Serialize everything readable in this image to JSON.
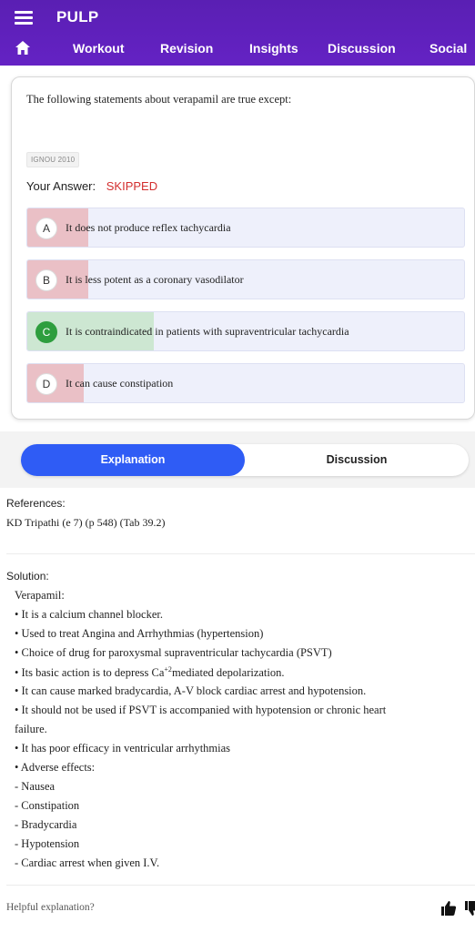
{
  "app": {
    "title": "PULP",
    "nav": [
      "Workout",
      "Revision",
      "Insights",
      "Discussion",
      "Social"
    ]
  },
  "question": {
    "text": "The following statements about verapamil are true except:",
    "source_tag": "IGNOU 2010",
    "your_answer_label": "Your Answer:",
    "your_answer_value": "SKIPPED",
    "options": [
      {
        "letter": "A",
        "text": "It does not produce reflex tachycardia",
        "status": "wrong",
        "response_share": 0.14
      },
      {
        "letter": "B",
        "text": "It is less potent as a coronary vasodilator",
        "status": "wrong",
        "response_share": 0.14
      },
      {
        "letter": "C",
        "text": "It is contraindicated in patients with supraventricular tachycardia",
        "status": "correct",
        "response_share": 0.29
      },
      {
        "letter": "D",
        "text": "It can cause constipation",
        "status": "wrong",
        "response_share": 0.13
      }
    ]
  },
  "tabs": {
    "explanation": "Explanation",
    "discussion": "Discussion"
  },
  "explanation": {
    "references_heading": "References:",
    "references_text": "KD Tripathi (e 7) (p 548) (Tab 39.2)",
    "solution_heading": "Solution:",
    "solution_lines": [
      "Verapamil:",
      "•  It is a calcium channel blocker.",
      "•  Used to treat Angina and Arrhythmias (hypertension)",
      "• Choice of drug for paroxysmal supraventricular tachycardia (PSVT)",
      "• Its basic action is to depress Ca",
      "+2",
      "mediated depolarization.",
      "•  It can cause marked bradycardia, A-V block cardiac arrest and hypotension.",
      "•  It should not be used if PSVT is accompanied with hypotension or chronic heart",
      "failure.",
      "•  It has poor efficacy in ventricular arrhythmias",
      "•  Adverse effects:",
      "-   Nausea",
      "-   Constipation",
      "-   Bradycardia",
      "-   Hypotension",
      "-   Cardiac arrest when given I.V."
    ],
    "helpful_prompt": "Helpful explanation?"
  },
  "colors": {
    "appbar": "#5b21b6",
    "tab_active": "#2f5cf5",
    "wrong_fill": "#eac0c6",
    "correct_fill": "#cde7d2",
    "correct_badge": "#2e9e3e",
    "skipped": "#d32f2f"
  },
  "icons": [
    "menu-icon",
    "home-icon",
    "thumbs-up-icon",
    "thumbs-down-icon"
  ]
}
